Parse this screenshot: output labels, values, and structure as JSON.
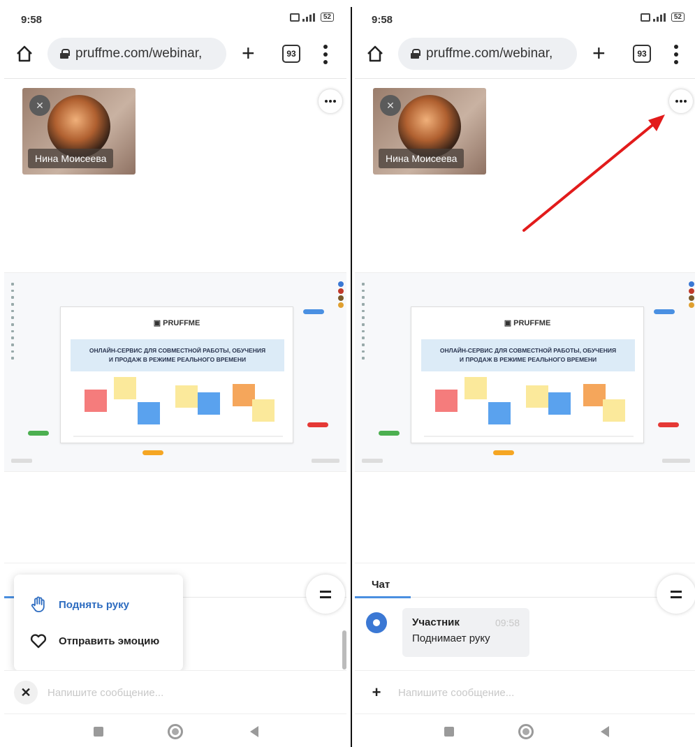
{
  "statusbar": {
    "time": "9:58",
    "battery": "52"
  },
  "browser": {
    "url": "pruffme.com/webinar,",
    "tabs_count": "93"
  },
  "video": {
    "participant_name": "Нина Моисеева"
  },
  "slide": {
    "logo_text": "PRUFFME",
    "headline_line1": "ОНЛАЙН-СЕРВИС ДЛЯ СОВМЕСТНОЙ РАБОТЫ, ОБУЧЕНИЯ",
    "headline_line2": "И ПРОДАЖ В РЕЖИМЕ РЕАЛЬНОГО ВРЕМЕНИ"
  },
  "popup": {
    "raise_hand": "Поднять руку",
    "send_emotion": "Отправить эмоцию"
  },
  "chat": {
    "tab_label": "Чат",
    "message": {
      "author": "Участник",
      "time": "09:58",
      "text": "Поднимает руку"
    }
  },
  "input": {
    "placeholder": "Напишите сообщение..."
  },
  "colors": {
    "accent": "#2d6cc0",
    "arrow": "#e21b1b",
    "sticky_red": "#f57c7c",
    "sticky_yellow": "#fbe99b",
    "sticky_blue": "#5aa2ee",
    "sticky_orange": "#f5a65b"
  }
}
